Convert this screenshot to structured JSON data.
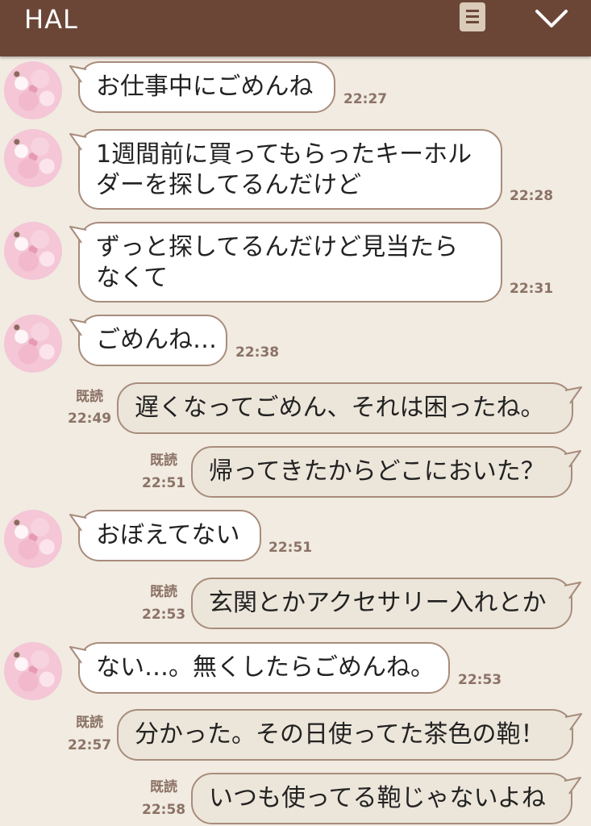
{
  "header": {
    "title": "HAL",
    "menu_icon": "menu-list-icon",
    "collapse_icon": "chevron-down-icon",
    "bar_color": "#6b4637"
  },
  "read_label": "既読",
  "messages": [
    {
      "side": "left",
      "text": "お仕事中にごめんね",
      "time": "22:27"
    },
    {
      "side": "left",
      "text": "1週間前に買ってもらったキーホル\nダーを探してるんだけど",
      "time": "22:28"
    },
    {
      "side": "left",
      "text": "ずっと探してるんだけど見当たら\nなくて",
      "time": "22:31"
    },
    {
      "side": "left",
      "text": "ごめんね…",
      "time": "22:38"
    },
    {
      "side": "right",
      "text": "遅くなってごめん、それは困ったね。",
      "time": "22:49",
      "read": "既読"
    },
    {
      "side": "right",
      "text": "帰ってきたからどこにおいた？",
      "time": "22:51",
      "read": "既読"
    },
    {
      "side": "left",
      "text": "おぼえてない",
      "time": "22:51"
    },
    {
      "side": "right",
      "text": "玄関とかアクセサリー入れとか",
      "time": "22:53",
      "read": "既読"
    },
    {
      "side": "left",
      "text": "ない…。無くしたらごめんね。",
      "time": "22:53"
    },
    {
      "side": "right",
      "text": "分かった。その日使ってた茶色の鞄！",
      "time": "22:57",
      "read": "既読"
    },
    {
      "side": "right",
      "text": "いつも使ってる鞄じゃないよね",
      "time": "22:58",
      "read": "既読"
    }
  ],
  "colors": {
    "background": "#f1ebe1",
    "bubble_border": "#a88c7c",
    "own_bubble": "#ece6da",
    "partner_bubble": "#ffffff",
    "meta_text": "#8c7266"
  }
}
